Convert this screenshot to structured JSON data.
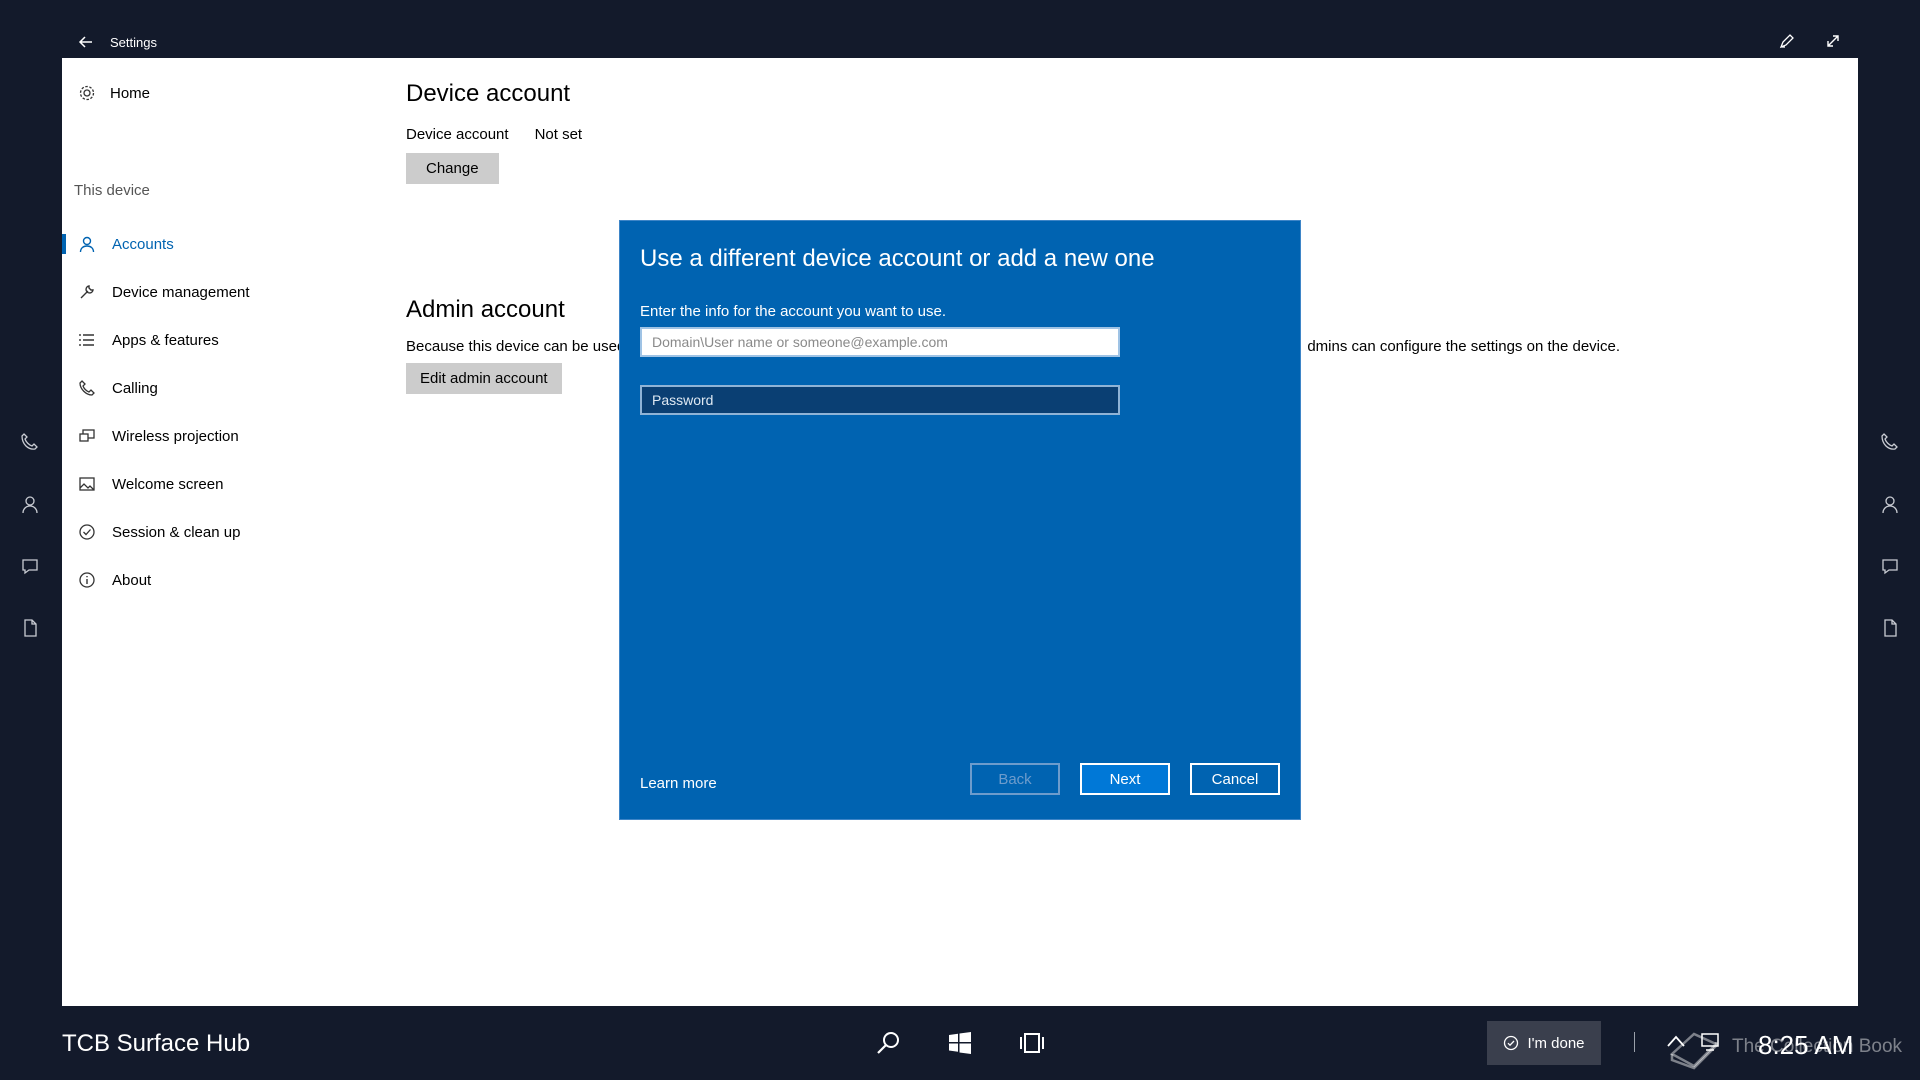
{
  "titlebar": {
    "title": "Settings"
  },
  "sidebar": {
    "home_label": "Home",
    "section_label": "This device",
    "items": [
      {
        "label": "Accounts",
        "icon": "person-icon",
        "active": true
      },
      {
        "label": "Device management",
        "icon": "wrench-icon"
      },
      {
        "label": "Apps & features",
        "icon": "list-icon"
      },
      {
        "label": "Calling",
        "icon": "phone-icon"
      },
      {
        "label": "Wireless projection",
        "icon": "projection-icon"
      },
      {
        "label": "Welcome screen",
        "icon": "image-icon"
      },
      {
        "label": "Session & clean up",
        "icon": "check-circle-icon"
      },
      {
        "label": "About",
        "icon": "info-icon"
      }
    ]
  },
  "main": {
    "device_account": {
      "heading": "Device account",
      "label": "Device account",
      "value": "Not set",
      "change_button": "Change"
    },
    "admin_account": {
      "heading": "Admin account",
      "description_start": "Because this device can be used",
      "description_end": "dmins can configure the settings on the device.",
      "edit_button": "Edit admin account"
    }
  },
  "dialog": {
    "title": "Use a different device account or add a new one",
    "subtitle": "Enter the info for the account you want to use.",
    "username_placeholder": "Domain\\User name or someone@example.com",
    "username_value": "",
    "password_placeholder": "Password",
    "learn_more": "Learn more",
    "back_button": "Back",
    "next_button": "Next",
    "cancel_button": "Cancel"
  },
  "taskbar": {
    "device_name": "TCB Surface Hub",
    "done_button": "I'm done",
    "clock": "8:25 AM"
  },
  "watermark": "The Collection Book",
  "colors": {
    "accent": "#0063b1",
    "dialog_bg": "#0063b1",
    "desktop_bg": "#131a2b"
  }
}
